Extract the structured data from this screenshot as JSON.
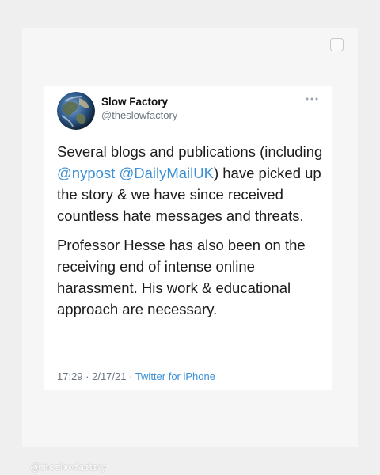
{
  "tweet": {
    "author_name": "Slow Factory",
    "author_handle": "@theslowfactory",
    "text": {
      "p1_part1": "Several blogs and publications (including ",
      "p1_mention1": "@nypost",
      "p1_space": " ",
      "p1_mention2": "@DailyMailUK",
      "p1_part2": ") have picked up the story & we have since received countless hate messages and threats.",
      "p2": "Professor Hesse has also been on the receiving end of intense online harassment. His work & educational approach are necessary."
    },
    "time": "17:29",
    "separator1": " · ",
    "date": "2/17/21",
    "separator2": " · ",
    "source": "Twitter for iPhone"
  },
  "watermark": "@theslowfactory",
  "icons": {
    "avatar": "earth-globe-avatar",
    "more": "more-options-icon",
    "panel": "square-select-icon"
  },
  "colors": {
    "link": "#3a8fd6",
    "muted": "#6b7580",
    "text": "#1c1c1c"
  }
}
